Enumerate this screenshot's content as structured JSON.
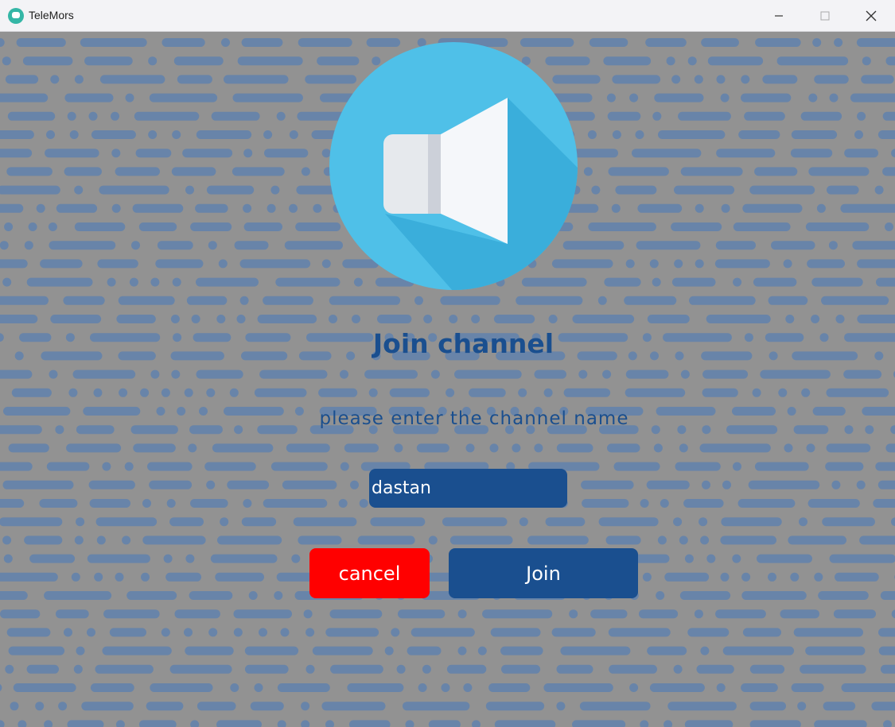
{
  "window": {
    "app_title": "TeleMors",
    "controls": {
      "minimize": "minimize-icon",
      "maximize": "maximize-icon",
      "close": "close-icon"
    }
  },
  "dialog": {
    "heading": "Join channel",
    "prompt": "please enter the channel name",
    "channel_input": {
      "value": "dastan",
      "placeholder": ""
    },
    "cancel_label": "cancel",
    "join_label": "Join"
  },
  "icons": {
    "logo": "speaker-icon",
    "app": "telemors-app-icon"
  },
  "colors": {
    "primary": "#1a4f8f",
    "danger": "#ff0000",
    "logo_circle": "#4fc0e8",
    "background_dash": "#5a7fb0",
    "background": "#929292"
  }
}
